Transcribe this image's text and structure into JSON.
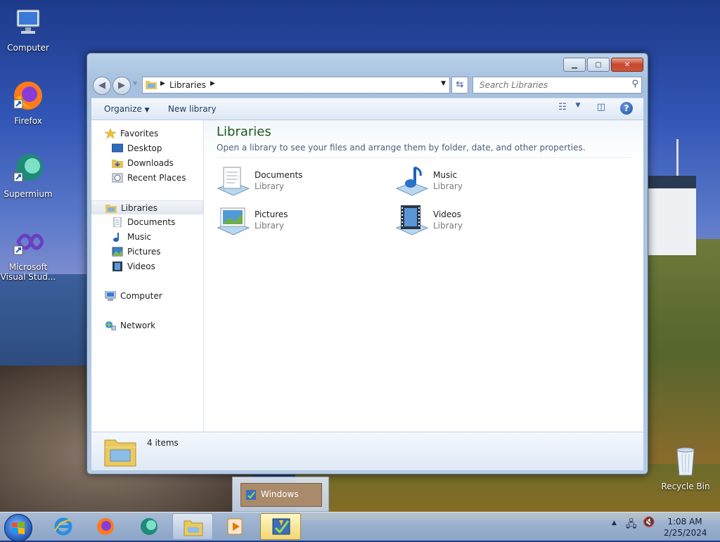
{
  "desktop": {
    "icons": [
      {
        "label": "Computer"
      },
      {
        "label": "Firefox"
      },
      {
        "label": "Supermium"
      },
      {
        "label": "Microsoft Visual Stud..."
      },
      {
        "label": "Recycle Bin"
      }
    ]
  },
  "window": {
    "address": {
      "crumb": "Libraries"
    },
    "search": {
      "placeholder": "Search Libraries"
    },
    "toolbar": {
      "organize": "Organize",
      "new_library": "New library"
    },
    "nav": {
      "favorites": "Favorites",
      "desktop": "Desktop",
      "downloads": "Downloads",
      "recent": "Recent Places",
      "libraries": "Libraries",
      "documents": "Documents",
      "music": "Music",
      "pictures": "Pictures",
      "videos": "Videos",
      "computer": "Computer",
      "network": "Network"
    },
    "main": {
      "title": "Libraries",
      "subtitle": "Open a library to see your files and arrange them by folder, date, and other properties.",
      "libraries": [
        {
          "name": "Documents",
          "type": "Library"
        },
        {
          "name": "Music",
          "type": "Library"
        },
        {
          "name": "Pictures",
          "type": "Library"
        },
        {
          "name": "Videos",
          "type": "Library"
        }
      ]
    },
    "status": {
      "count": "4 items"
    }
  },
  "taskbar": {
    "preview_label": "Windows",
    "clock": {
      "time": "1:08 AM",
      "date": "2/25/2024"
    }
  },
  "colors": {
    "title_green": "#1e5a1e",
    "link_blue": "#1e395b",
    "close_red": "#c7452b"
  }
}
